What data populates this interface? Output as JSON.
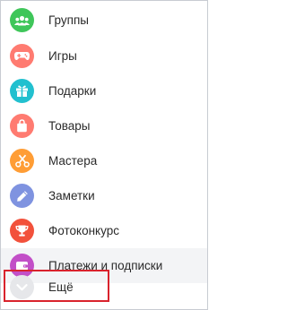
{
  "menu": {
    "items": [
      {
        "label": "Группы",
        "icon": "groups-icon",
        "color": "#3fc65a"
      },
      {
        "label": "Игры",
        "icon": "gamepad-icon",
        "color": "#ff7b71"
      },
      {
        "label": "Подарки",
        "icon": "gift-icon",
        "color": "#22c0cf"
      },
      {
        "label": "Товары",
        "icon": "shopping-bag-icon",
        "color": "#ff7b71"
      },
      {
        "label": "Мастера",
        "icon": "scissors-icon",
        "color": "#ff9d35"
      },
      {
        "label": "Заметки",
        "icon": "pencil-icon",
        "color": "#7f93e0"
      },
      {
        "label": "Фотоконкурс",
        "icon": "trophy-icon",
        "color": "#f2513b"
      },
      {
        "label": "Платежи и подписки",
        "icon": "wallet-icon",
        "color": "#c24fc7"
      }
    ],
    "more": {
      "label": "Ещё",
      "icon": "chevron-down-icon",
      "color": "#e6e7ea"
    },
    "highlight_color": "#d9232d"
  }
}
